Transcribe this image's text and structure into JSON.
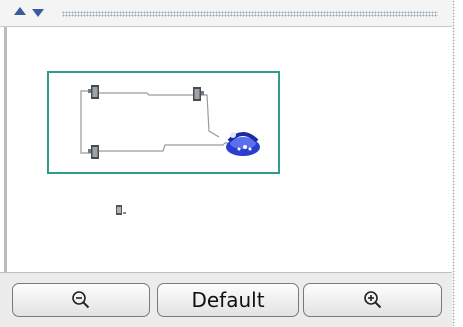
{
  "toolbar": {
    "collapse_icon": "arrow-up-icon",
    "expand_icon": "arrow-down-icon"
  },
  "overview": {
    "nodes": [
      "device-icon",
      "device-icon",
      "device-icon",
      "phone-icon"
    ],
    "frame_color": "#2f9c8f"
  },
  "buttons": {
    "zoom_out_icon": "zoom-out-icon",
    "default_label": "Default",
    "zoom_in_icon": "zoom-in-icon"
  },
  "colors": {
    "accent": "#3a5b9c",
    "phone": "#2a3fd0"
  }
}
